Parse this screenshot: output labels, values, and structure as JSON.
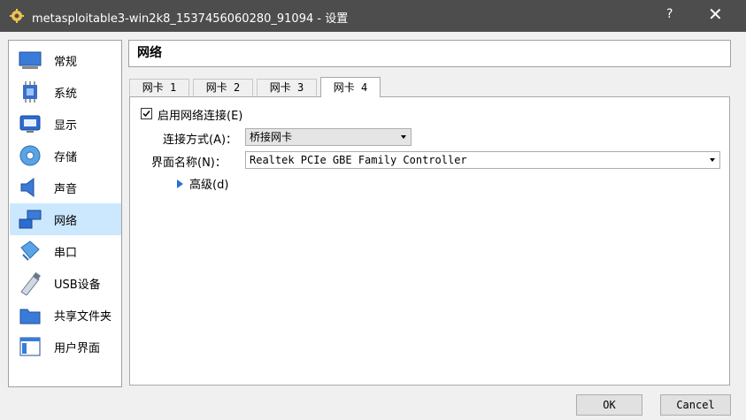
{
  "window": {
    "title": "metasploitable3-win2k8_1537456060280_91094 - 设置",
    "help_label": "?",
    "close_label": "✕"
  },
  "sidebar": {
    "items": [
      {
        "label": "常规",
        "icon": "general-icon"
      },
      {
        "label": "系统",
        "icon": "system-icon"
      },
      {
        "label": "显示",
        "icon": "display-icon"
      },
      {
        "label": "存储",
        "icon": "storage-icon"
      },
      {
        "label": "声音",
        "icon": "audio-icon"
      },
      {
        "label": "网络",
        "icon": "network-icon",
        "selected": true
      },
      {
        "label": "串口",
        "icon": "serial-port-icon"
      },
      {
        "label": "USB设备",
        "icon": "usb-icon"
      },
      {
        "label": "共享文件夹",
        "icon": "shared-folder-icon"
      },
      {
        "label": "用户界面",
        "icon": "user-interface-icon"
      }
    ]
  },
  "panel": {
    "title": "网络",
    "tabs": [
      {
        "label": "网卡 1"
      },
      {
        "label": "网卡 2"
      },
      {
        "label": "网卡 3"
      },
      {
        "label": "网卡 4",
        "active": true
      }
    ],
    "enable_label": "启用网络连接(E)",
    "enable_checked": true,
    "attached_label": "连接方式(A)：",
    "attached_value": "桥接网卡",
    "name_label": "界面名称(N)：",
    "name_value": "Realtek PCIe GBE Family Controller",
    "advanced_label": "高级(d)"
  },
  "buttons": {
    "ok": "OK",
    "cancel": "Cancel"
  },
  "colors": {
    "titlebar": "#4d4d4d",
    "selected_bg": "#cce8ff",
    "accent": "#2a6fd6"
  }
}
